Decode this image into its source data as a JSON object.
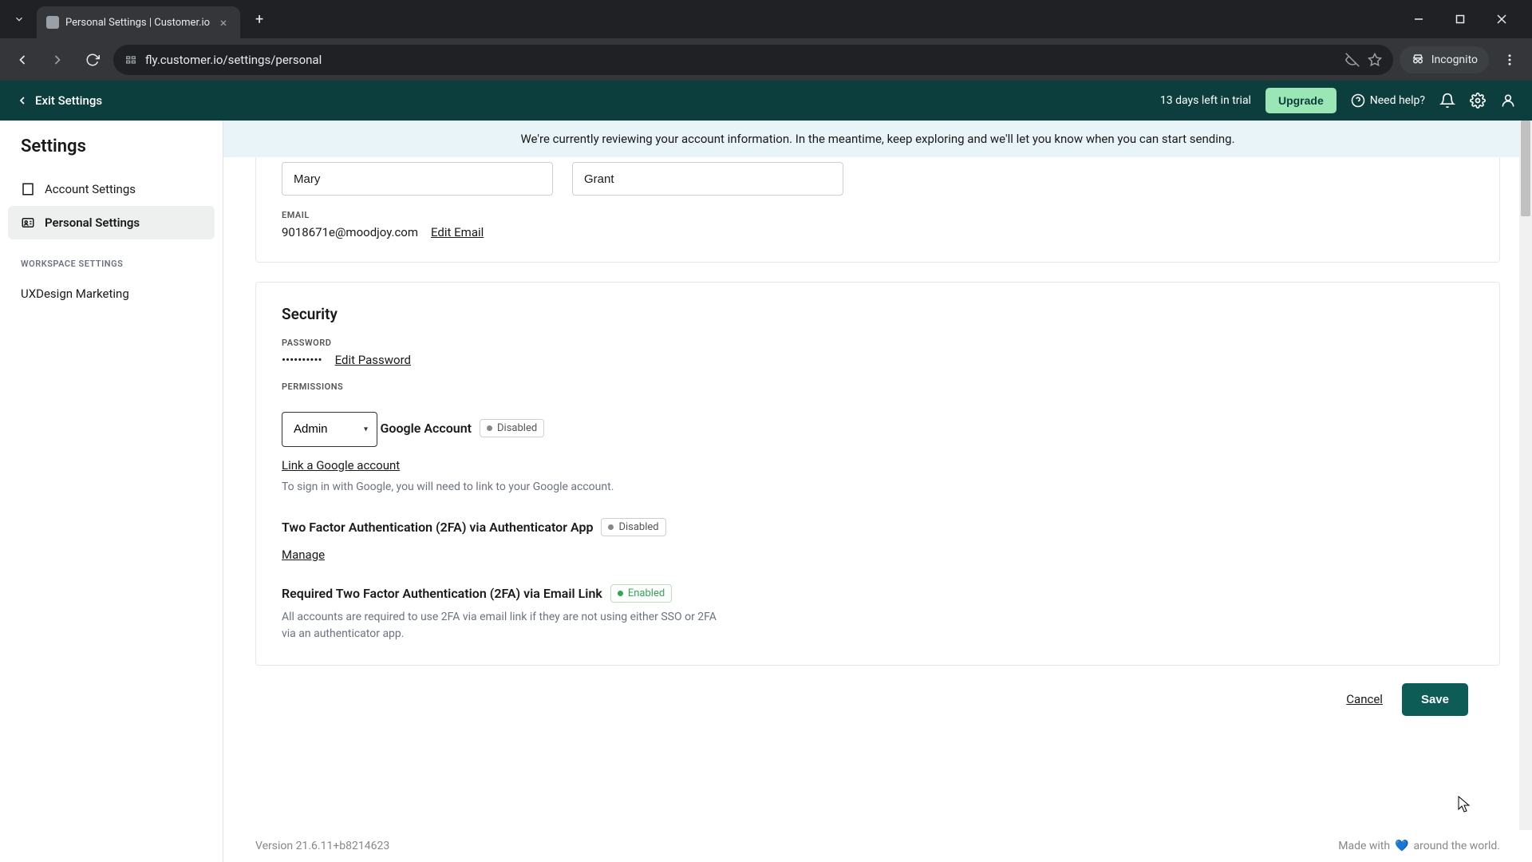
{
  "browser": {
    "tab_title": "Personal Settings | Customer.io",
    "url": "fly.customer.io/settings/personal",
    "incognito_label": "Incognito"
  },
  "header": {
    "exit_label": "Exit Settings",
    "trial_text": "13 days left in trial",
    "upgrade_label": "Upgrade",
    "need_help_label": "Need help?"
  },
  "sidebar": {
    "title": "Settings",
    "items": [
      {
        "label": "Account Settings"
      },
      {
        "label": "Personal Settings"
      }
    ],
    "workspace_section_label": "WORKSPACE SETTINGS",
    "workspace_item": "UXDesign Marketing"
  },
  "banner": {
    "text": "We're currently reviewing your account information. In the meantime, keep exploring and we'll let you know when you can start sending."
  },
  "profile": {
    "first_name": "Mary",
    "last_name": "Grant",
    "email_label": "EMAIL",
    "email_value": "9018671e@moodjoy.com",
    "edit_email_label": "Edit Email"
  },
  "security": {
    "title": "Security",
    "password_label": "PASSWORD",
    "password_masked": "••••••••••",
    "edit_password_label": "Edit Password",
    "permissions_label": "PERMISSIONS",
    "permissions_value": "Admin",
    "google": {
      "title": "Google Account",
      "status": "Disabled",
      "link_label": "Link a Google account",
      "help": "To sign in with Google, you will need to link to your Google account."
    },
    "tfa_app": {
      "title": "Two Factor Authentication (2FA) via Authenticator App",
      "status": "Disabled",
      "manage_label": "Manage"
    },
    "tfa_email": {
      "title": "Required Two Factor Authentication (2FA) via Email Link",
      "status": "Enabled",
      "help": "All accounts are required to use 2FA via email link if they are not using either SSO or 2FA via an authenticator app."
    }
  },
  "actions": {
    "cancel_label": "Cancel",
    "save_label": "Save"
  },
  "footer": {
    "version": "Version 21.6.11+b8214623",
    "made_with_prefix": "Made with",
    "made_with_suffix": "around the world."
  },
  "colors": {
    "header_bg": "#0d3e3e",
    "upgrade_bg": "#9ae6b4",
    "save_bg": "#0d5c56"
  }
}
